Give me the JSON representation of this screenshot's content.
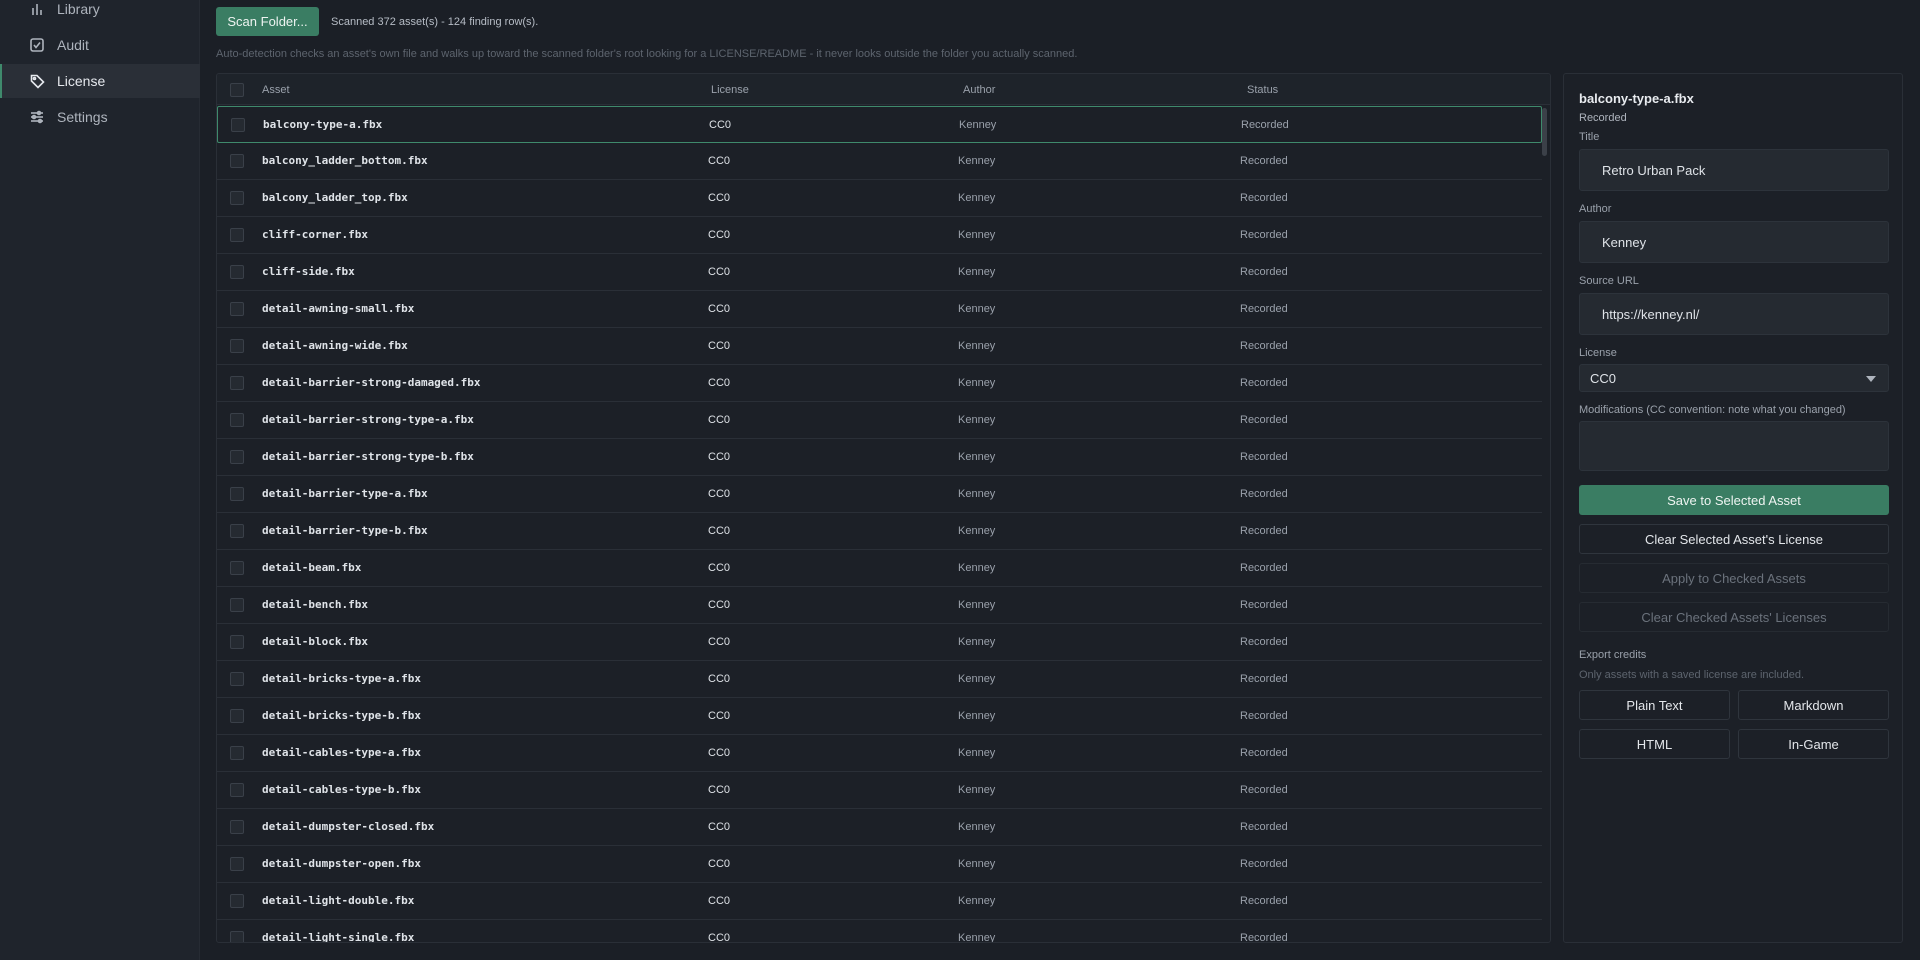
{
  "sidebar": {
    "items": [
      {
        "label": "Library",
        "icon": "bar-chart-icon",
        "active": false
      },
      {
        "label": "Audit",
        "icon": "checkbox-icon",
        "active": false
      },
      {
        "label": "License",
        "icon": "tag-icon",
        "active": true
      },
      {
        "label": "Settings",
        "icon": "sliders-icon",
        "active": false
      }
    ]
  },
  "toolbar": {
    "scan_label": "Scan Folder...",
    "summary": "Scanned 372 asset(s) - 124 finding row(s).",
    "hint": "Auto-detection checks an asset's own file and walks up toward the scanned folder's root looking for a LICENSE/README - it never looks outside the folder you actually scanned."
  },
  "table": {
    "headers": {
      "asset": "Asset",
      "license": "License",
      "author": "Author",
      "status": "Status"
    },
    "rows": [
      {
        "asset": "balcony-type-a.fbx",
        "license": "CC0",
        "author": "Kenney",
        "status": "Recorded"
      },
      {
        "asset": "balcony_ladder_bottom.fbx",
        "license": "CC0",
        "author": "Kenney",
        "status": "Recorded"
      },
      {
        "asset": "balcony_ladder_top.fbx",
        "license": "CC0",
        "author": "Kenney",
        "status": "Recorded"
      },
      {
        "asset": "cliff-corner.fbx",
        "license": "CC0",
        "author": "Kenney",
        "status": "Recorded"
      },
      {
        "asset": "cliff-side.fbx",
        "license": "CC0",
        "author": "Kenney",
        "status": "Recorded"
      },
      {
        "asset": "detail-awning-small.fbx",
        "license": "CC0",
        "author": "Kenney",
        "status": "Recorded"
      },
      {
        "asset": "detail-awning-wide.fbx",
        "license": "CC0",
        "author": "Kenney",
        "status": "Recorded"
      },
      {
        "asset": "detail-barrier-strong-damaged.fbx",
        "license": "CC0",
        "author": "Kenney",
        "status": "Recorded"
      },
      {
        "asset": "detail-barrier-strong-type-a.fbx",
        "license": "CC0",
        "author": "Kenney",
        "status": "Recorded"
      },
      {
        "asset": "detail-barrier-strong-type-b.fbx",
        "license": "CC0",
        "author": "Kenney",
        "status": "Recorded"
      },
      {
        "asset": "detail-barrier-type-a.fbx",
        "license": "CC0",
        "author": "Kenney",
        "status": "Recorded"
      },
      {
        "asset": "detail-barrier-type-b.fbx",
        "license": "CC0",
        "author": "Kenney",
        "status": "Recorded"
      },
      {
        "asset": "detail-beam.fbx",
        "license": "CC0",
        "author": "Kenney",
        "status": "Recorded"
      },
      {
        "asset": "detail-bench.fbx",
        "license": "CC0",
        "author": "Kenney",
        "status": "Recorded"
      },
      {
        "asset": "detail-block.fbx",
        "license": "CC0",
        "author": "Kenney",
        "status": "Recorded"
      },
      {
        "asset": "detail-bricks-type-a.fbx",
        "license": "CC0",
        "author": "Kenney",
        "status": "Recorded"
      },
      {
        "asset": "detail-bricks-type-b.fbx",
        "license": "CC0",
        "author": "Kenney",
        "status": "Recorded"
      },
      {
        "asset": "detail-cables-type-a.fbx",
        "license": "CC0",
        "author": "Kenney",
        "status": "Recorded"
      },
      {
        "asset": "detail-cables-type-b.fbx",
        "license": "CC0",
        "author": "Kenney",
        "status": "Recorded"
      },
      {
        "asset": "detail-dumpster-closed.fbx",
        "license": "CC0",
        "author": "Kenney",
        "status": "Recorded"
      },
      {
        "asset": "detail-dumpster-open.fbx",
        "license": "CC0",
        "author": "Kenney",
        "status": "Recorded"
      },
      {
        "asset": "detail-light-double.fbx",
        "license": "CC0",
        "author": "Kenney",
        "status": "Recorded"
      },
      {
        "asset": "detail-light-single.fbx",
        "license": "CC0",
        "author": "Kenney",
        "status": "Recorded"
      }
    ]
  },
  "panel": {
    "title": "balcony-type-a.fbx",
    "status": "Recorded",
    "title_label": "Title",
    "title_value": "Retro Urban Pack",
    "author_label": "Author",
    "author_value": "Kenney",
    "source_label": "Source URL",
    "source_value": "https://kenney.nl/",
    "license_label": "License",
    "license_value": "CC0",
    "mods_label": "Modifications (CC convention: note what you changed)",
    "save_label": "Save to Selected Asset",
    "clear_selected_label": "Clear Selected Asset's License",
    "apply_checked_label": "Apply to Checked Assets",
    "clear_checked_label": "Clear Checked Assets' Licenses",
    "export_label": "Export credits",
    "export_hint": "Only assets with a saved license are included.",
    "export_plain": "Plain Text",
    "export_markdown": "Markdown",
    "export_html": "HTML",
    "export_ingame": "In-Game"
  },
  "colors": {
    "accent": "#3a7d63",
    "background": "#1b1f26"
  }
}
